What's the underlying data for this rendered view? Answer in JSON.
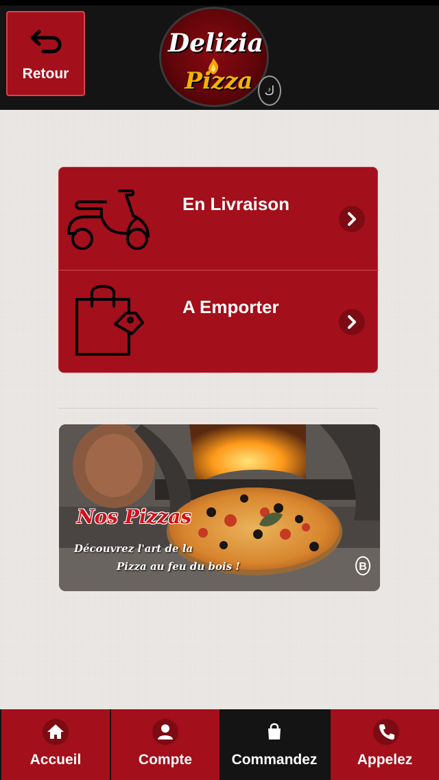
{
  "header": {
    "back_label": "Retour",
    "logo_word1": "Delizia",
    "logo_word2": "Pizza",
    "logo_stamp": "ك"
  },
  "order_options": [
    {
      "title": "En Livraison",
      "icon": "scooter-icon"
    },
    {
      "title": "A Emporter",
      "icon": "shopping-bag-icon"
    }
  ],
  "banner": {
    "title": "Nos Pizzas",
    "line1": "Découvrez l'art de la",
    "line2": "Pizza au feu du bois !",
    "mark": "B"
  },
  "tabbar": {
    "items": [
      {
        "label": "Accueil",
        "icon": "home-icon"
      },
      {
        "label": "Compte",
        "icon": "user-icon"
      },
      {
        "label": "Commandez",
        "icon": "shopping-bag-icon",
        "active": true
      },
      {
        "label": "Appelez",
        "icon": "phone-icon"
      }
    ]
  },
  "colors": {
    "brand_red": "#a30f1a",
    "dark": "#141414",
    "background": "#ece9e6"
  }
}
